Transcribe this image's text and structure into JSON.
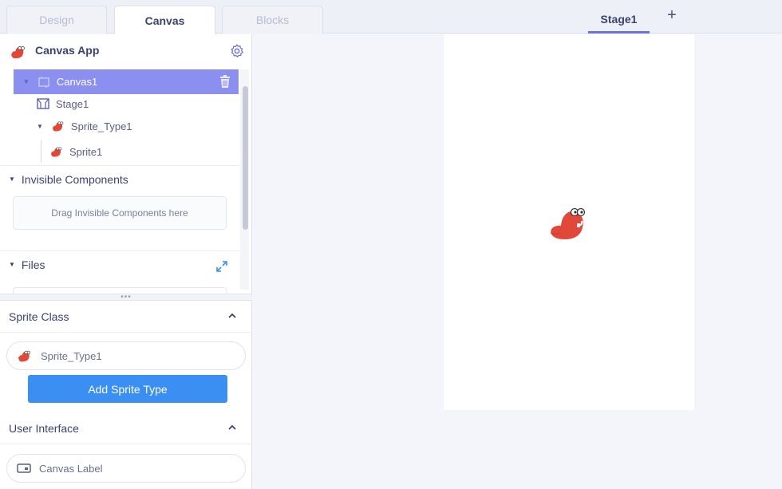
{
  "top_tabs": [
    {
      "label": "Design",
      "active": false
    },
    {
      "label": "Canvas",
      "active": true
    },
    {
      "label": "Blocks",
      "active": false
    }
  ],
  "stage_tab": {
    "label": "Stage1"
  },
  "add_stage": {
    "label": "+"
  },
  "app": {
    "title": "Canvas App",
    "icon": "sprite-icon"
  },
  "tree": {
    "canvas": "Canvas1",
    "stage": "Stage1",
    "sprite_type": "Sprite_Type1",
    "sprite": "Sprite1"
  },
  "invisible": {
    "title": "Invisible Components",
    "drop_hint": "Drag Invisible Components here"
  },
  "files": {
    "title": "Files"
  },
  "splitter": {
    "label": "•••"
  },
  "palette": {
    "sprite_class": {
      "title": "Sprite Class",
      "item": "Sprite_Type1",
      "add_button": "Add Sprite Type"
    },
    "user_interface": {
      "title": "User Interface",
      "item": "Canvas Label"
    }
  },
  "colors": {
    "accent": "#8b8ff0",
    "button": "#3b8ff2",
    "sprite": "#e2483a"
  }
}
